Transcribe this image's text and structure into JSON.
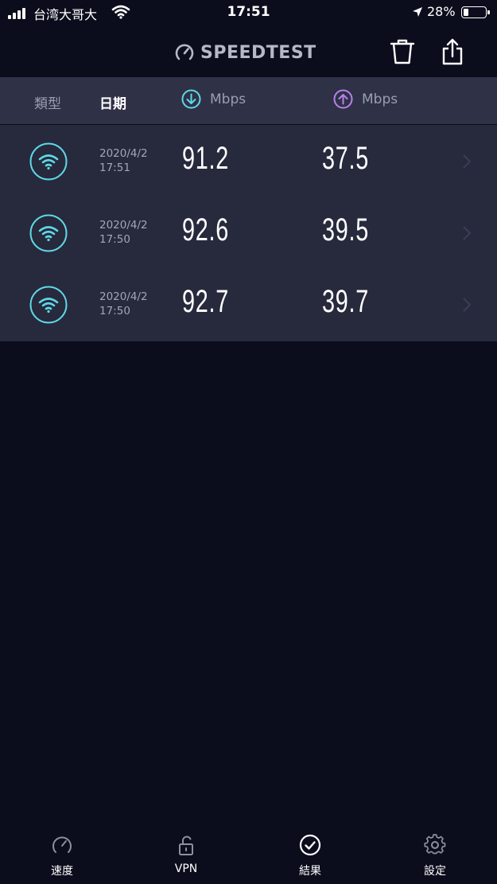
{
  "status_bar": {
    "carrier": "台湾大哥大",
    "time": "17:51",
    "battery": "28%"
  },
  "app": {
    "title": "SPEEDTEST",
    "icons": {
      "trash": "trash-icon",
      "share": "share-icon"
    }
  },
  "columns": {
    "type": "類型",
    "date": "日期",
    "download_unit": "Mbps",
    "upload_unit": "Mbps"
  },
  "colors": {
    "download": "#5fd8e4",
    "upload": "#b882e8",
    "background": "#0b0d1c",
    "header_bg": "#2f3147",
    "rows_bg": "#27293d"
  },
  "results": [
    {
      "connection": "wifi",
      "date": "2020/4/2",
      "time": "17:51",
      "download": "91.2",
      "upload": "37.5"
    },
    {
      "connection": "wifi",
      "date": "2020/4/2",
      "time": "17:50",
      "download": "92.6",
      "upload": "39.5"
    },
    {
      "connection": "wifi",
      "date": "2020/4/2",
      "time": "17:50",
      "download": "92.7",
      "upload": "39.7"
    }
  ],
  "tabs": [
    {
      "label": "速度",
      "icon": "gauge-icon"
    },
    {
      "label": "VPN",
      "icon": "lock-icon"
    },
    {
      "label": "結果",
      "icon": "check-circle-icon",
      "active": true
    },
    {
      "label": "設定",
      "icon": "gear-icon"
    }
  ]
}
